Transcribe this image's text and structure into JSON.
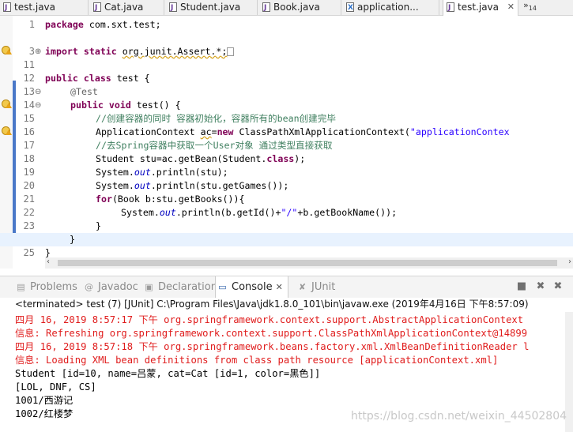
{
  "editor_tabs": [
    {
      "label": "test.java",
      "icon": "java-file-icon"
    },
    {
      "label": "Cat.java",
      "icon": "java-file-icon"
    },
    {
      "label": "Student.java",
      "icon": "java-file-icon"
    },
    {
      "label": "Book.java",
      "icon": "java-file-icon"
    },
    {
      "label": "application...",
      "icon": "xml-file-icon"
    },
    {
      "label": "test.java",
      "icon": "java-file-icon",
      "active": true,
      "close": "✕"
    }
  ],
  "tab_overflow": {
    "symbol": "»",
    "count": "14"
  },
  "line_numbers": [
    "1",
    "3",
    "11",
    "12",
    "13",
    "14",
    "15",
    "16",
    "17",
    "18",
    "19",
    "20",
    "21",
    "22",
    "23",
    "24",
    "25"
  ],
  "code": {
    "l1_kw": "package",
    "l1_rest": " com.sxt.test;",
    "l3_kw1": "import",
    "l3_kw2": "static",
    "l3_rest": "org.junit.Assert.*;",
    "l12_kw1": "public",
    "l12_kw2": "class",
    "l12_rest": " test {",
    "l13_anno": "@Test",
    "l14_kw1": "public",
    "l14_kw2": "void",
    "l14_rest": " test() {",
    "l15_comment": "//创建容器的同时 容器初始化，容器所有的bean创建完毕",
    "l16_a": "ApplicationContext ",
    "l16_var": "ac",
    "l16_b": "=",
    "l16_kw": "new",
    "l16_c": " ClassPathXmlApplicationContext(",
    "l16_str": "\"applicationContex",
    "l17_comment": "//去Spring容器中获取一个User对象 通过类型直接获取",
    "l18_a": "Student stu=ac.getBean(Student.",
    "l18_kw": "class",
    "l18_b": ");",
    "l19_a": "System.",
    "l19_fd": "out",
    "l19_b": ".println(stu);",
    "l20_a": "System.",
    "l20_fd": "out",
    "l20_b": ".println(stu.getGames());",
    "l21_kw": "for",
    "l21_rest": "(Book b:stu.getBooks()){",
    "l22_a": "System.",
    "l22_fd": "out",
    "l22_b": ".println(b.getId()+",
    "l22_str": "\"/\"",
    "l22_c": "+b.getBookName());",
    "l23": "}",
    "l24": "}",
    "l25": "}"
  },
  "view_tabs": [
    {
      "label": "Problems",
      "icon": "problems-icon"
    },
    {
      "label": "Javadoc",
      "icon": "javadoc-icon"
    },
    {
      "label": "Declaration",
      "icon": "declaration-icon"
    },
    {
      "label": "Console",
      "icon": "console-icon",
      "active": true,
      "close": "✕"
    },
    {
      "label": "JUnit",
      "icon": "junit-icon"
    }
  ],
  "console": {
    "terminated": "<terminated> test (7) [JUnit] C:\\Program Files\\Java\\jdk1.8.0_101\\bin\\javaw.exe (2019年4月16日 下午8:57:09)",
    "lines": [
      "四月 16, 2019 8:57:17 下午 org.springframework.context.support.AbstractApplicationContext",
      "信息: Refreshing org.springframework.context.support.ClassPathXmlApplicationContext@14899",
      "四月 16, 2019 8:57:18 下午 org.springframework.beans.factory.xml.XmlBeanDefinitionReader l",
      "信息: Loading XML bean definitions from class path resource [applicationContext.xml]",
      "Student [id=10, name=吕蒙, cat=Cat [id=1, color=黑色]]",
      "[LOL, DNF, CS]",
      "1001/西游记",
      "1002/红楼梦"
    ]
  },
  "watermark": "https://blog.csdn.net/weixin_44502804",
  "colors": {
    "keyword": "#7f0055",
    "comment": "#3f7f5f",
    "string": "#2a00ff",
    "field": "#0000c0",
    "stderr": "#e01c1c"
  }
}
